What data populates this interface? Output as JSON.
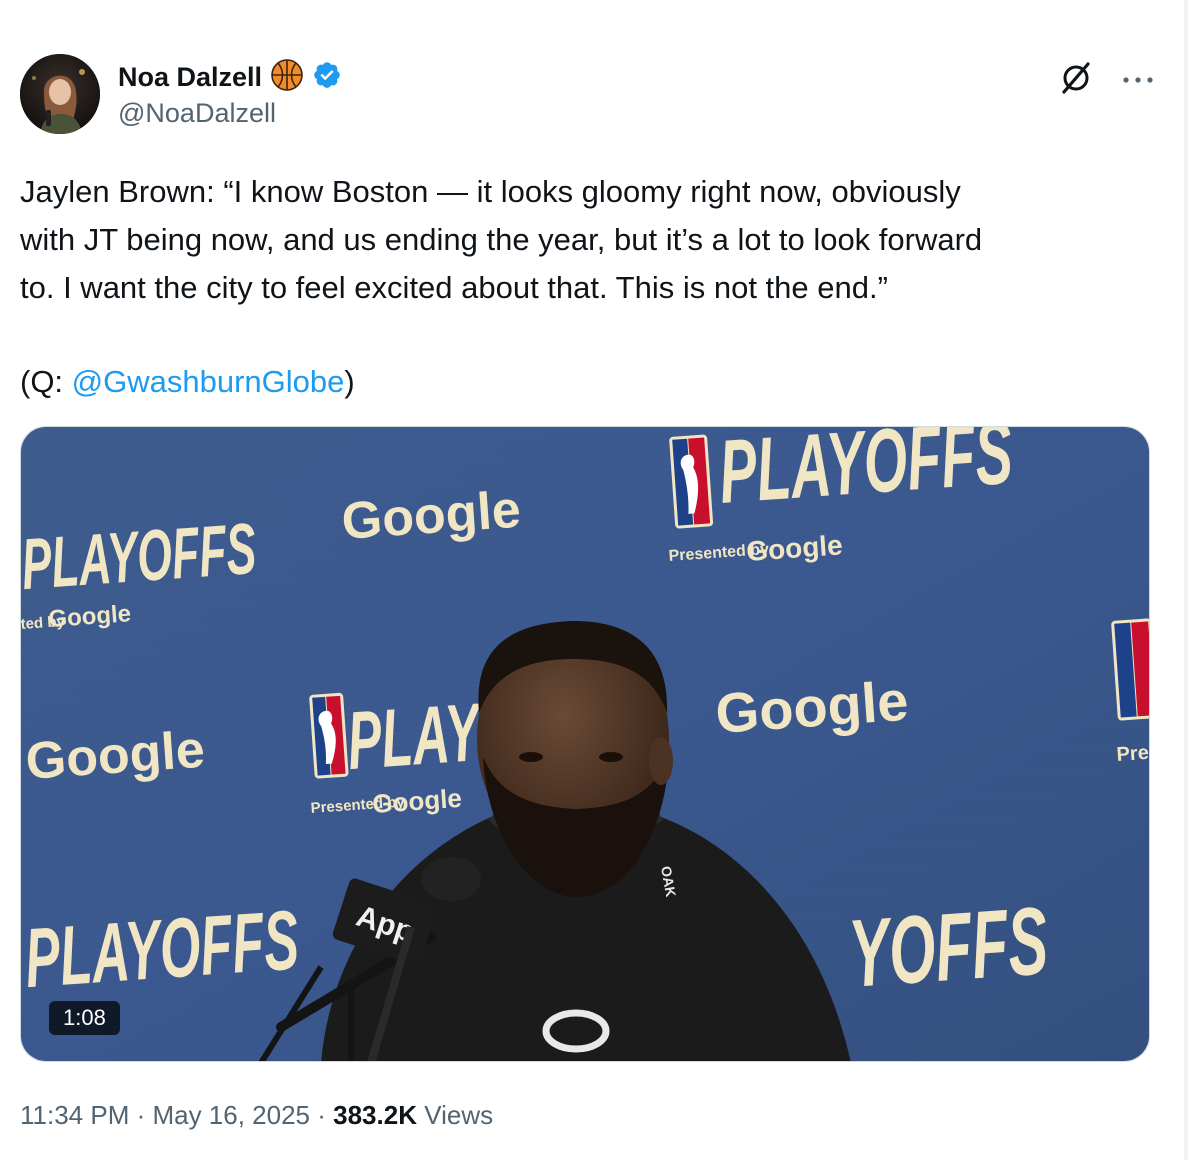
{
  "author": {
    "name": "Noa Dalzell",
    "handle": "@NoaDalzell",
    "emoji_icon": "basketball-icon",
    "verified_icon": "verified-badge-icon"
  },
  "actions": {
    "grok_icon": "grok-icon",
    "more_label": "···"
  },
  "tweet": {
    "text": "Jaylen Brown: “I know Boston — it looks gloomy right now, obviously\nwith JT being now, and us ending the year, but it’s a lot to look forward\nto. I want the city to feel excited about that. This is not the end.”",
    "mention_prefix": "(Q: ",
    "mention": "@GwashburnGlobe",
    "mention_suffix": ")"
  },
  "media": {
    "duration": "1:08",
    "backdrop_words": {
      "playoffs": "PLAYOFFS",
      "playoffs_partial": "PLAY",
      "playoffs_partial_right": "YOFFS",
      "google": "Google",
      "presented_by": "Presented by",
      "presented_partial": "ted by",
      "nba": "NBA",
      "prese": "Prese",
      "mic_label": "App"
    }
  },
  "meta": {
    "time": "11:34 PM",
    "separator": " · ",
    "date": "May 16, 2025",
    "views_count": "383.2K",
    "views_label": " Views"
  },
  "colors": {
    "accent": "#1d9bf0",
    "backdrop_blue": "#3f5e91",
    "logo_gold": "#f1e6c4"
  }
}
